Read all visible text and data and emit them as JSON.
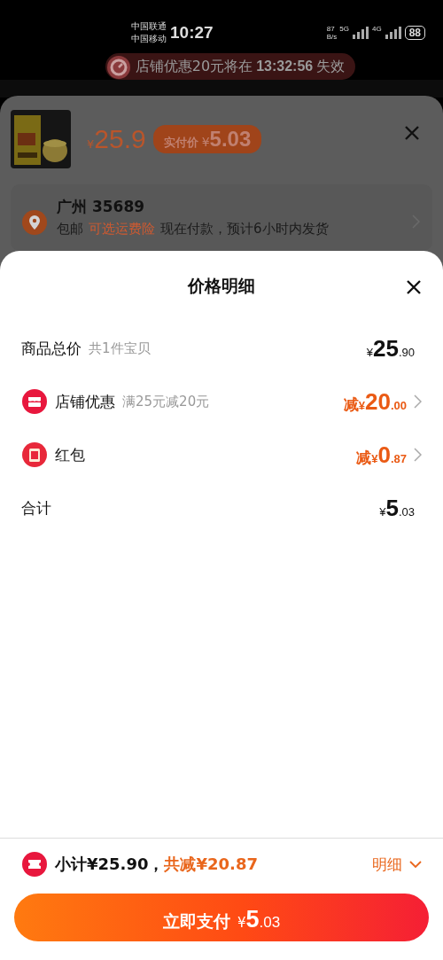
{
  "status_bar": {
    "carriers": [
      "中国联通",
      "中国移动"
    ],
    "time": "10:27",
    "speed": "87",
    "speed_unit": "B/s",
    "net1": "5G",
    "net2": "4G",
    "battery": "88"
  },
  "promo_banner": {
    "text": "店铺优惠20元将在",
    "countdown": "13:32:56",
    "suffix": "失效"
  },
  "product_sheet": {
    "currency": "¥",
    "price": "25.9",
    "badge_label": "实付价",
    "badge_currency": "¥",
    "badge_price": "5.03"
  },
  "address": {
    "title": "广州 35689",
    "shipping": "包邮",
    "insurance": "可选运费险",
    "delivery": "现在付款，预计6小时内发货"
  },
  "detail": {
    "title": "价格明细",
    "rows": [
      {
        "kind": "plain",
        "label": "商品总价",
        "note": "共1件宝贝",
        "prefix": "",
        "currency": "¥",
        "integer": "25",
        "decimal": ".90",
        "discount": false,
        "expandable": false
      },
      {
        "kind": "store",
        "label": "店铺优惠",
        "note": "满25元减20元",
        "prefix": "减",
        "currency": "¥",
        "integer": "20",
        "decimal": ".00",
        "discount": true,
        "expandable": true
      },
      {
        "kind": "redpacket",
        "label": "红包",
        "note": "",
        "prefix": "减",
        "currency": "¥",
        "integer": "0",
        "decimal": ".87",
        "discount": true,
        "expandable": true
      },
      {
        "kind": "plain",
        "label": "合计",
        "note": "",
        "prefix": "",
        "currency": "¥",
        "integer": "5",
        "decimal": ".03",
        "discount": false,
        "expandable": false
      }
    ]
  },
  "footer": {
    "subtotal": "小计¥25.90，",
    "savings": "共减¥20.87",
    "detail_toggle": "明细",
    "expanded": true,
    "pay_label": "立即支付",
    "pay_currency": "¥",
    "pay_integer": "5",
    "pay_decimal": ".03"
  }
}
